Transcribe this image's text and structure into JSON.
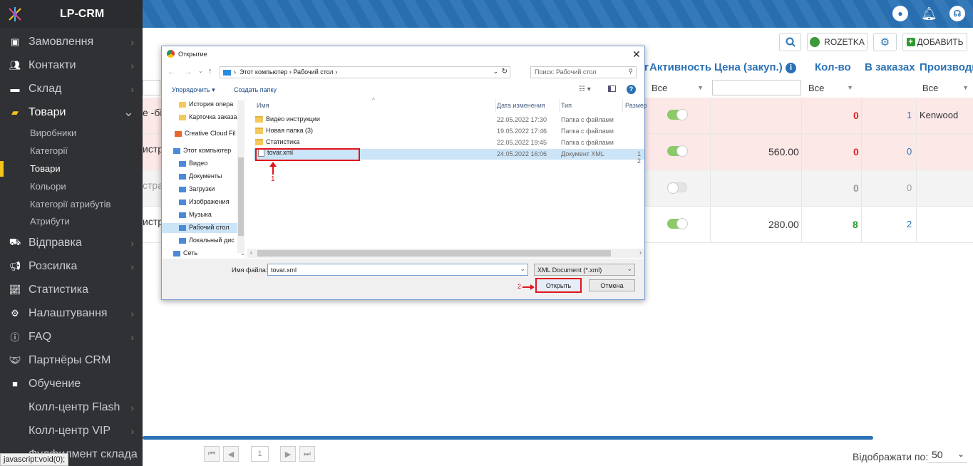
{
  "app": {
    "brand": "LP-CRM"
  },
  "sidebar": {
    "items": [
      {
        "label": "Замовлення",
        "icon": "cart-icon"
      },
      {
        "label": "Контакти",
        "icon": "users-icon"
      },
      {
        "label": "Склад",
        "icon": "box-icon"
      },
      {
        "label": "Товари",
        "icon": "tag-icon"
      },
      {
        "label": "Відправка",
        "icon": "truck-icon"
      },
      {
        "label": "Розсилка",
        "icon": "megaphone-icon"
      },
      {
        "label": "Статистика",
        "icon": "chart-icon"
      },
      {
        "label": "Налаштування",
        "icon": "gear-icon"
      },
      {
        "label": "FAQ",
        "icon": "info-icon"
      },
      {
        "label": "Партнёры CRM",
        "icon": "handshake-icon"
      },
      {
        "label": "Обучение",
        "icon": "video-icon"
      },
      {
        "label": "Колл-центр Flash",
        "icon": ""
      },
      {
        "label": "Колл-центр VIP",
        "icon": ""
      },
      {
        "label": "Фулфилмент склада",
        "icon": ""
      }
    ],
    "subitems": [
      "Виробники",
      "Категорії",
      "Товари",
      "Кольори",
      "Категорії атрибутів",
      "Атрибути"
    ]
  },
  "toolbar": {
    "rozetka": "ROZETKA",
    "add": "ДОБАВИТЬ"
  },
  "table": {
    "headers": {
      "active": "Активность",
      "price": "Цена (закуп.)",
      "qty": "Кол-во",
      "orders": "В заказах",
      "maker": "Производи"
    },
    "filters": {
      "all": "Все"
    },
    "left_fragments": [
      "е -бі",
      "истр",
      "стра",
      "истр"
    ],
    "rows": [
      {
        "price": "",
        "qty": "0",
        "orders": "1",
        "maker": "Kenwood"
      },
      {
        "price": "560.00",
        "qty": "0",
        "orders": "0",
        "maker": ""
      },
      {
        "price": "",
        "qty": "0",
        "orders": "0",
        "maker": ""
      },
      {
        "price": "280.00",
        "qty": "8",
        "orders": "2",
        "maker": ""
      }
    ]
  },
  "dialog": {
    "title": "Открытие",
    "path_pc": "Этот компьютер",
    "path_desktop": "Рабочий стол",
    "search_placeholder": "Поиск: Рабочий стол",
    "organize": "Упорядочить",
    "new_folder": "Создать папку",
    "cols": {
      "name": "Имя",
      "date": "Дата изменения",
      "type": "Тип",
      "size": "Размер"
    },
    "files": [
      {
        "name": "Видео инструкции",
        "date": "22.05.2022 17:30",
        "type": "Папка с файлами"
      },
      {
        "name": "Новая папка (3)",
        "date": "19.05.2022 17:46",
        "type": "Папка с файлами"
      },
      {
        "name": "Статистика",
        "date": "22.05.2022 19:45",
        "type": "Папка с файлами"
      },
      {
        "name": "tovar.xml",
        "date": "24.05.2022 16:06",
        "type": "Документ XML",
        "size": "1 2"
      }
    ],
    "tree": [
      "История опера",
      "Карточка заказа",
      "Creative Cloud Fil",
      "Этот компьютер",
      "Видео",
      "Документы",
      "Загрузки",
      "Изображения",
      "Музыка",
      "Рабочий стол",
      "Локальный дис",
      "Сеть"
    ],
    "filename_label": "Имя файла:",
    "filename_value": "tovar.xml",
    "filetype": "XML Document (*.xml)",
    "open": "Открыть",
    "cancel": "Отмена",
    "marker1": "1",
    "marker2": "2"
  },
  "footer": {
    "page": "1",
    "per_page_label": "Відображати по:",
    "per_page_value": "50",
    "status": "javascript:void(0);"
  }
}
